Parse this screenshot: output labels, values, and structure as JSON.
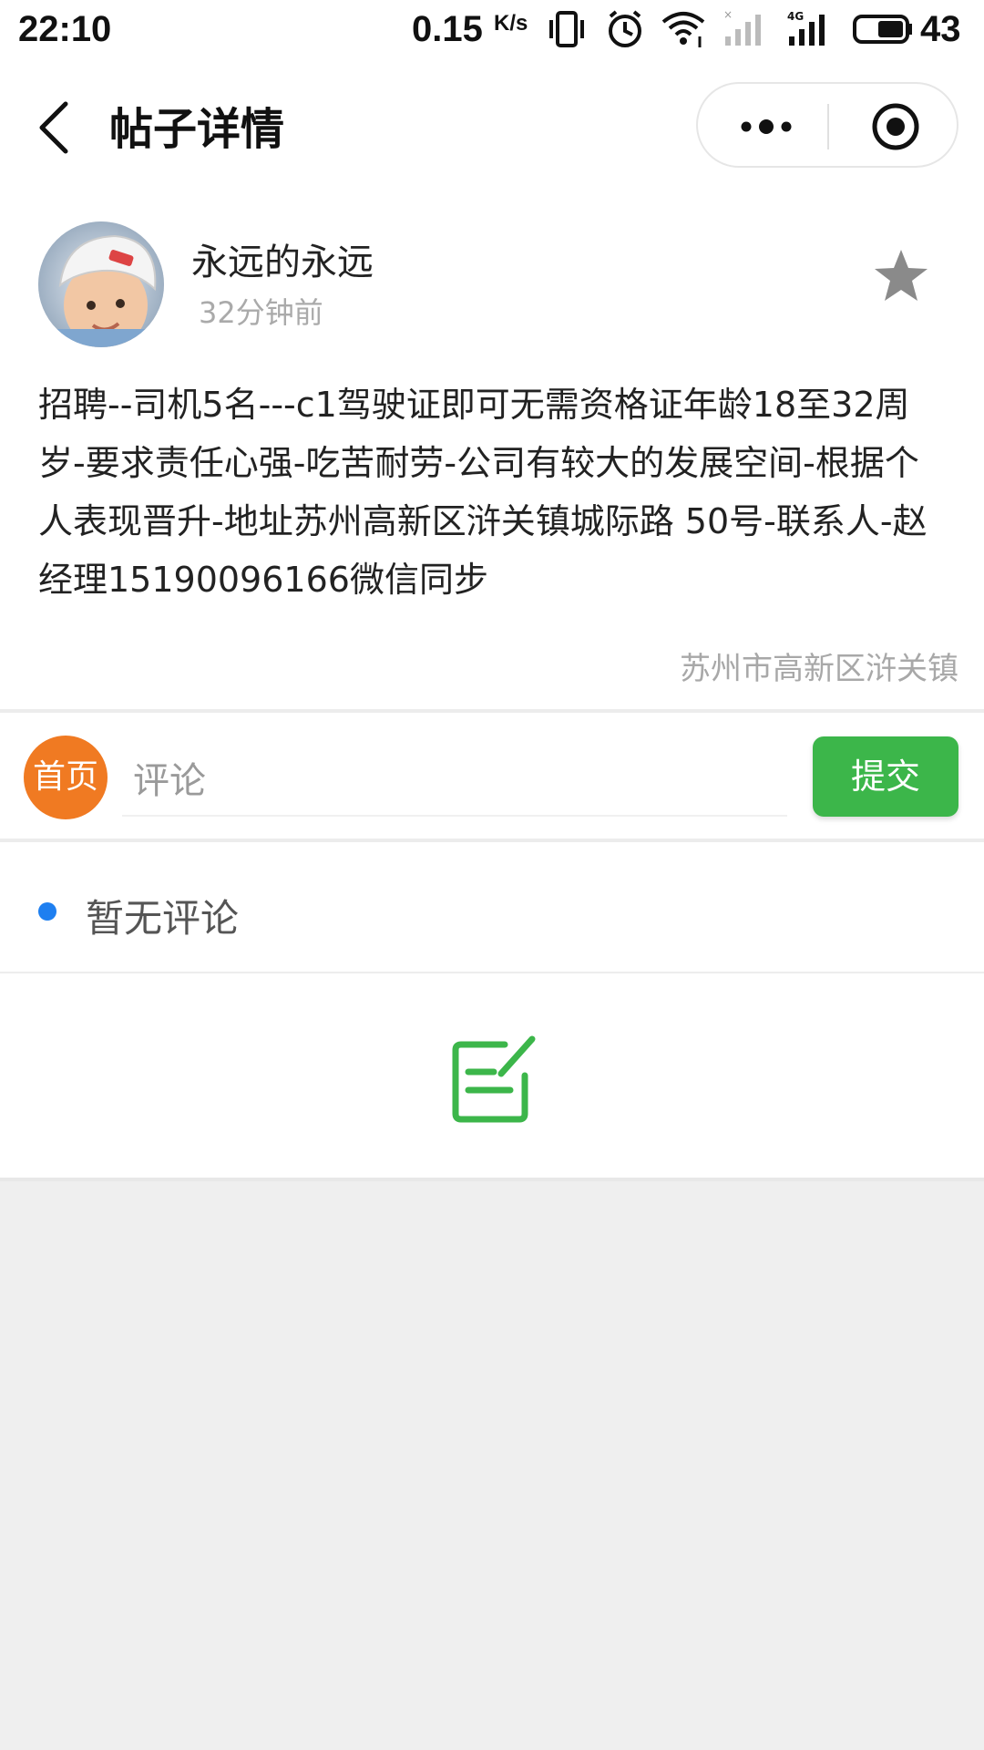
{
  "status_bar": {
    "time": "22:10",
    "net_speed": "0.15",
    "net_speed_unit": "K/s",
    "battery": "43",
    "icons": [
      "vibrate-icon",
      "alarm-icon",
      "wifi-icon",
      "signal-sim1-icon",
      "signal-4g-icon",
      "battery-icon"
    ]
  },
  "nav": {
    "title": "帖子详情",
    "icons": [
      "back-arrow-icon",
      "more-dots-icon",
      "close-target-icon"
    ]
  },
  "post": {
    "user_name": "永远的永远",
    "time_ago": "32分钟前",
    "content": " 招聘--司机5名---c1驾驶证即可无需资格证年龄18至32周岁-要求责任心强-吃苦耐劳-公司有较大的发展空间-根据个人表现晋升-地址苏州高新区浒关镇城际路 50号-联系人-赵经理15190096166微信同步",
    "location": "苏州市高新区浒关镇",
    "icons": [
      "avatar-photo",
      "star-icon"
    ]
  },
  "comment_bar": {
    "home_label": "首页",
    "input_placeholder": "评论",
    "submit_label": "提交"
  },
  "comments": {
    "empty_text": "暂无评论"
  },
  "colors": {
    "home_orange": "#f07a22",
    "submit_green": "#3cb64a",
    "bullet_blue": "#1e7ff0",
    "edit_icon_green": "#3cb64a"
  }
}
